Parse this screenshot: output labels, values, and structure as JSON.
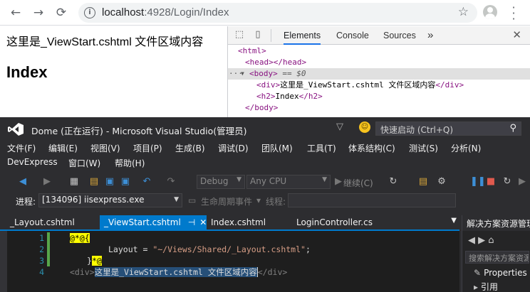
{
  "browser": {
    "url_host": "localhost",
    "url_rest": ":4928/Login/Index"
  },
  "page": {
    "layout_text": "这里是_ViewStart.cshtml 文件区域内容",
    "heading": "Index"
  },
  "devtools": {
    "tabs": [
      "Elements",
      "Console",
      "Sources"
    ],
    "more": "»",
    "dom": {
      "html_open": "<html>",
      "head": "<head></head>",
      "body_open": "<body>",
      "body_eq": "== $0",
      "div_open": "<div>",
      "div_text": "这里是_ViewStart.cshtml 文件区域内容",
      "div_close": "</div>",
      "h2_open": "<h2>",
      "h2_text": "Index",
      "h2_close": "</h2>",
      "body_close": "</body>"
    }
  },
  "vs": {
    "title": "Dome (正在运行) - Microsoft Visual Studio(管理员)",
    "quick_launch": "快速启动 (Ctrl+Q)",
    "menu_row1": [
      "文件(F)",
      "编辑(E)",
      "视图(V)",
      "项目(P)",
      "生成(B)",
      "调试(D)",
      "团队(M)",
      "工具(T)",
      "体系结构(C)",
      "测试(S)",
      "分析(N)"
    ],
    "menu_row2": [
      "DevExpress",
      "窗口(W)",
      "帮助(H)"
    ],
    "toolbar": {
      "config": "Debug",
      "platform": "Any CPU",
      "continue": "继续(C)"
    },
    "process": {
      "label": "进程:",
      "value": "[134096] iisexpress.exe",
      "lifecycle": "生命周期事件",
      "thread": "线程:"
    },
    "tabs": [
      {
        "label": "_Layout.cshtml"
      },
      {
        "label": "_ViewStart.cshtml",
        "pin": "⊣",
        "close": "✕"
      },
      {
        "label": "Index.cshtml"
      },
      {
        "label": "LoginController.cs"
      }
    ],
    "code": {
      "line_numbers": [
        "1",
        "2",
        "3",
        "4"
      ],
      "l1_razor": "@*@{",
      "l2_prefix": "Layout = ",
      "l2_string": "\"~/Views/Shared/_Layout.cshtml\"",
      "l2_suffix": ";",
      "l3_brace": "}",
      "l3_razor": "*@",
      "l4_open": "<div>",
      "l4_text": "这里是_ViewStart.cshtml 文件区域内容",
      "l4_close": "</div>"
    },
    "solution": {
      "title": "解决方案资源管理器",
      "search": "搜索解决方案资源管",
      "item_props": "Properties",
      "item_refs": "引用"
    }
  }
}
